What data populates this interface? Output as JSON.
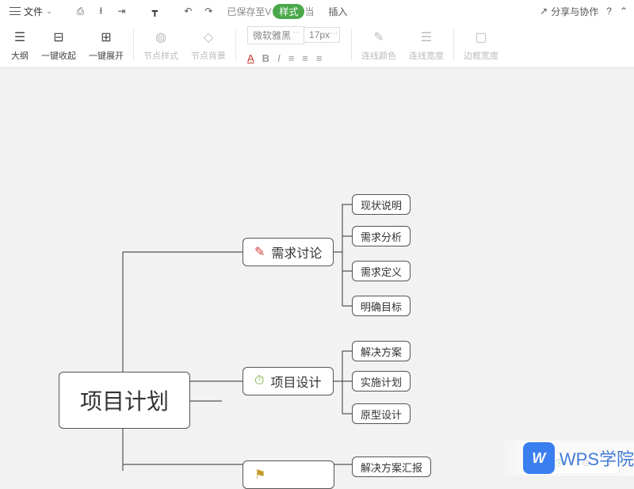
{
  "menubar": {
    "file_label": "文件",
    "status_prefix": "已保存至V",
    "badge": "样式",
    "status_suffix": "当",
    "insert": "插入",
    "share": "分享与协作"
  },
  "ribbon": {
    "outline": "大纲",
    "collapse": "一键收起",
    "expand": "一键展开",
    "node_style": "节点样式",
    "node_bg": "节点背景",
    "font_name": "微软雅黑",
    "font_size": "17px",
    "line_color": "连线颜色",
    "line_width": "连线宽度",
    "border_width": "边框宽度"
  },
  "mindmap": {
    "root": "项目计划",
    "b1": "需求讨论",
    "b1_children": [
      "现状说明",
      "需求分析",
      "需求定义",
      "明确目标"
    ],
    "b2": "项目设计",
    "b2_children": [
      "解决方案",
      "实施计划",
      "原型设计"
    ],
    "b3_child": "解决方案汇报"
  },
  "floatbar": {
    "percent": "⊕"
  },
  "watermark": {
    "logo": "W",
    "text": "WPS学院"
  }
}
